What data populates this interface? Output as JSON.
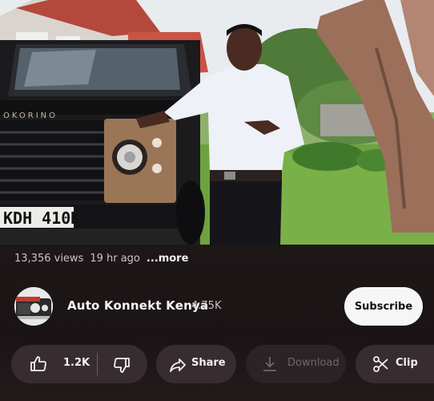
{
  "video": {
    "plate_text": "KDH 410K",
    "grille_text": "OKORINO"
  },
  "meta": {
    "views": "13,356 views",
    "age": "19 hr ago",
    "more": "...more"
  },
  "channel": {
    "name": "Auto Konnekt Kenya",
    "subscribers": "4.75K",
    "subscribe_label": "Subscribe"
  },
  "actions": {
    "like_count": "1.2K",
    "share_label": "Share",
    "download_label": "Download",
    "clip_label": "Clip"
  },
  "icons": {
    "like": "thumbs-up-icon",
    "dislike": "thumbs-down-icon",
    "share": "share-arrow-icon",
    "download": "download-icon",
    "clip": "scissors-icon"
  },
  "colors": {
    "background": "#1a1416",
    "pill": "#372d30",
    "subscribe_bg": "#f6f6f6"
  }
}
